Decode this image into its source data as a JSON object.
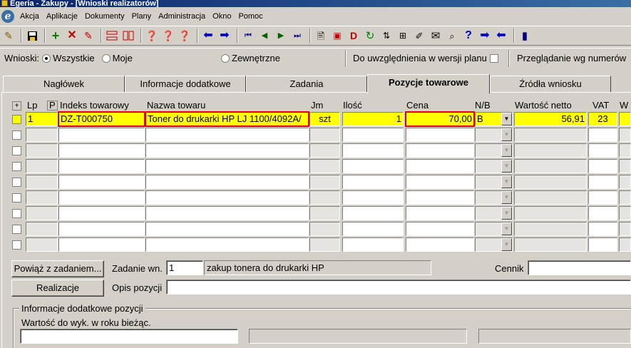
{
  "window": {
    "title": "Egeria - Zakupy - [Wnioski realizatorów]"
  },
  "menu": {
    "logo": "e",
    "items": [
      "Akcja",
      "Aplikacje",
      "Dokumenty",
      "Plany",
      "Administracja",
      "Okno",
      "Pomoc"
    ]
  },
  "toolbar": {
    "icons": [
      "pin-icon",
      "save-icon",
      "add-icon",
      "delete-icon",
      "edit-icon",
      "split-icon",
      "merge-icon",
      "find-icon",
      "find-next-icon",
      "find-clear-icon",
      "back-icon",
      "forward-icon",
      "first-record-icon",
      "prev-record-icon",
      "next-record-icon",
      "last-record-icon",
      "print-icon",
      "printer-color-icon",
      "document-d-icon",
      "refresh-icon",
      "sort-icon",
      "tree-icon",
      "attach-icon",
      "mail-icon",
      "search-icon",
      "help-icon",
      "nav-right-icon",
      "nav-left-icon",
      "exit-icon"
    ]
  },
  "filter": {
    "label": "Wnioski:",
    "opt_all": "Wszystkie",
    "opt_mine": "Moje",
    "opt_external": "Zewnętrzne",
    "plan_label": "Do uwzględnienia w wersji planu",
    "view_label": "Przeglądanie wg numerów",
    "selected": "Wszystkie",
    "plan_checked": false
  },
  "tabs": [
    "Nagłówek",
    "Informacje dodatkowe",
    "Zadania",
    "Pozycje towarowe",
    "Źródła wniosku"
  ],
  "active_tab": "Pozycje towarowe",
  "grid": {
    "headers": {
      "plus": "+",
      "lp": "Lp",
      "p": "P",
      "index": "Indeks towarowy",
      "name": "Nazwa towaru",
      "jm": "Jm",
      "qty": "Ilość",
      "price": "Cena",
      "nb": "N/B",
      "net": "Wartość netto",
      "vat": "VAT",
      "extra": "W"
    },
    "rows": [
      {
        "lp": "1",
        "index": "DZ-T000750",
        "name": "Toner do drukarki  HP LJ 1100/4092A/",
        "jm": "szt",
        "qty": "1",
        "price": "70,00",
        "nb": "B",
        "net": "56,91",
        "vat": "23"
      }
    ],
    "empty_rows": 8
  },
  "form": {
    "link_button": "Powiąż z zadaniem...",
    "task_label": "Zadanie wn.",
    "task_no": "1",
    "task_desc": "zakup tonera do drukarki HP",
    "pricelist_label": "Cennik",
    "pricelist_value": "",
    "realizations_button": "Realizacje",
    "position_desc_label": "Opis pozycji",
    "position_desc_value": "",
    "group_title": "Informacje dodatkowe pozycji",
    "current_year_label": "Wartość do wyk. w roku bieżąc."
  },
  "colors": {
    "highlight_row": "#ffff00",
    "error_outline": "#e0001a",
    "title_bar": "#0a246a"
  }
}
